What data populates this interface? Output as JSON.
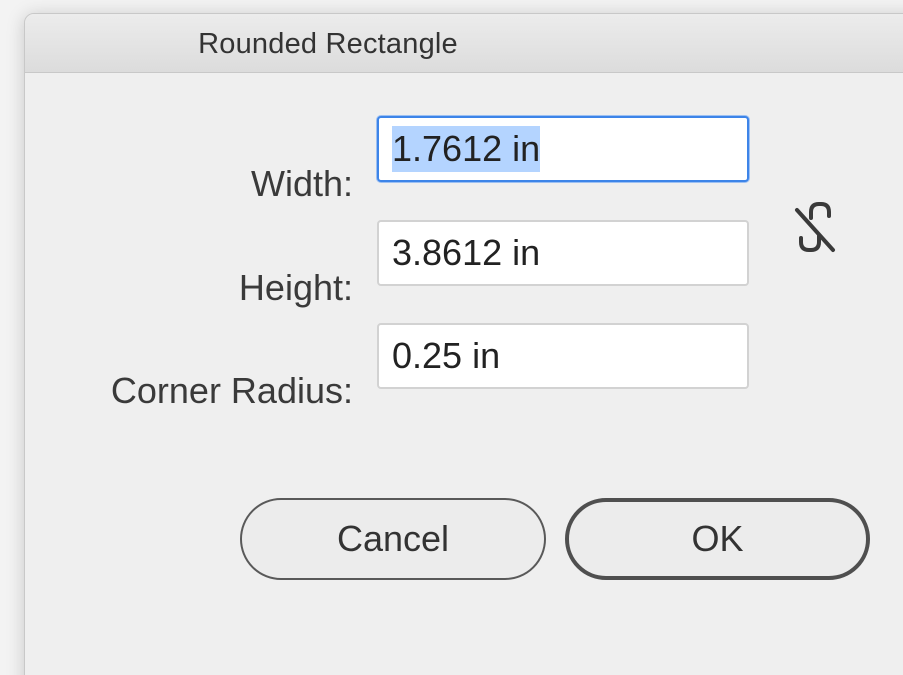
{
  "dialog": {
    "title": "Rounded Rectangle"
  },
  "fields": {
    "width": {
      "label": "Width:",
      "value": "1.7612 in"
    },
    "height": {
      "label": "Height:",
      "value": "3.8612 in"
    },
    "corner_radius": {
      "label": "Corner Radius:",
      "value": "0.25 in"
    }
  },
  "constrain_proportions": {
    "icon": "broken-link-icon",
    "state": "unlinked"
  },
  "buttons": {
    "cancel": "Cancel",
    "ok": "OK"
  },
  "colors": {
    "focus_border": "#3d84e8",
    "selection": "#b4d4ff"
  }
}
